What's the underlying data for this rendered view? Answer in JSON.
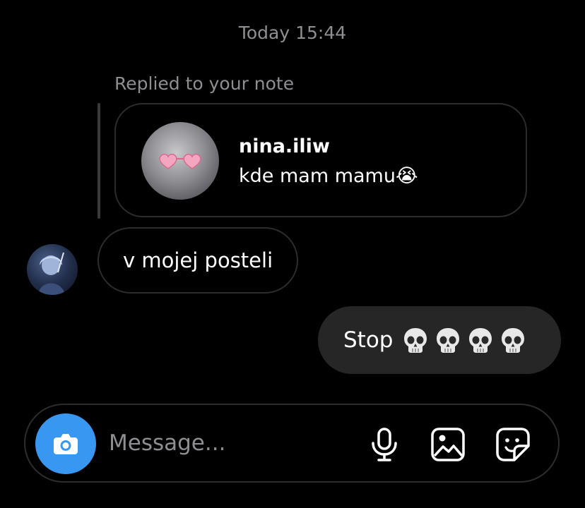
{
  "header": {
    "timestamp": "Today 15:44"
  },
  "reply_context": {
    "label": "Replied to your note",
    "note": {
      "username": "nina.iliw",
      "text": "kde mam mamu😭"
    }
  },
  "messages": [
    {
      "direction": "incoming",
      "text": "v mojej posteli"
    },
    {
      "direction": "outgoing",
      "text": "Stop",
      "emoji_icons": [
        "skull-emoji",
        "skull-emoji",
        "skull-emoji",
        "skull-emoji"
      ]
    }
  ],
  "composer": {
    "placeholder": "Message...",
    "icons": [
      "camera-icon",
      "microphone-icon",
      "gallery-icon",
      "sticker-icon"
    ]
  },
  "colors": {
    "background": "#000000",
    "muted_text": "#8e8e93",
    "outgoing_bubble": "#262626",
    "border": "#2c2c2e",
    "camera_accent": "#3897f0"
  }
}
